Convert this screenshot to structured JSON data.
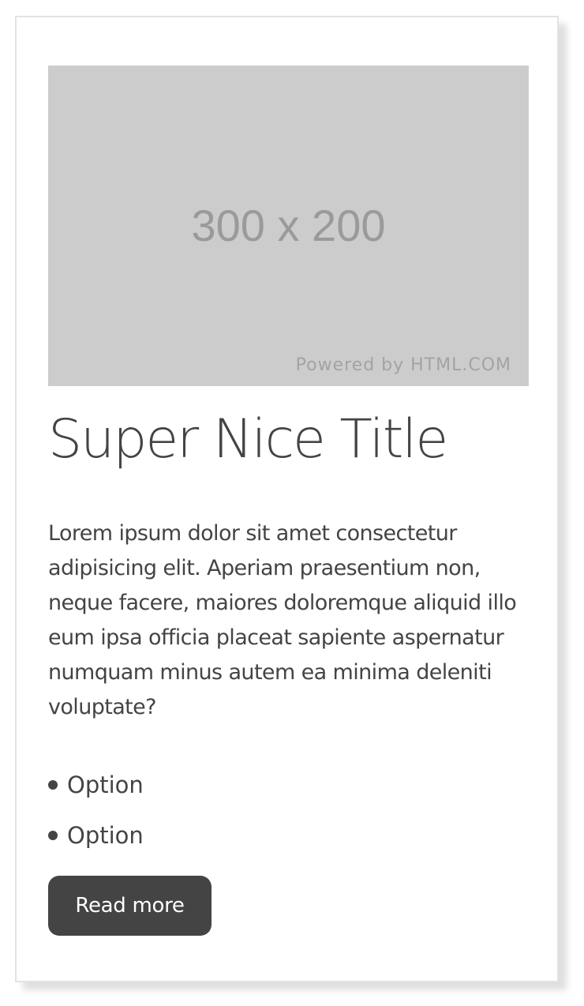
{
  "card": {
    "image": {
      "size_text": "300 x 200",
      "credit": "Powered by HTML.COM"
    },
    "title": "Super Nice Title",
    "body": "Lorem ipsum dolor sit amet consectetur adipisicing elit. Aperiam praesentium non, neque facere, maiores doloremque aliquid illo eum ipsa officia placeat sapiente aspernatur numquam minus autem ea minima deleniti voluptate?",
    "options": [
      "Option",
      "Option"
    ],
    "button_label": "Read more"
  },
  "colors": {
    "text": "#444444",
    "button_bg": "#444444",
    "button_text": "#ffffff",
    "placeholder_bg": "#cccccc",
    "card_border": "#e3e3e3"
  }
}
